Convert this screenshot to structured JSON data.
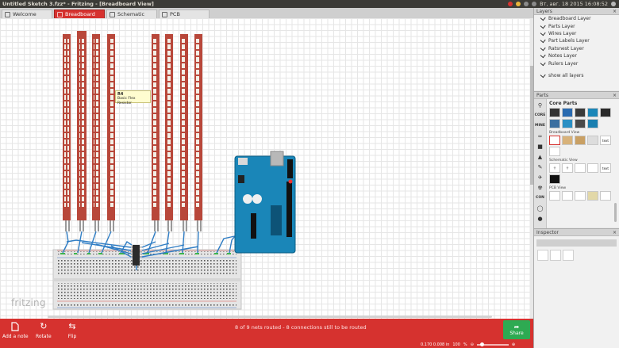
{
  "window": {
    "title": "Untitled Sketch 3.fzz* - Fritzing - [Breadboard View]",
    "clock": "Вт, авг. 18 2015 16:08:52"
  },
  "tabs": [
    {
      "label": "Welcome"
    },
    {
      "label": "Breadboard"
    },
    {
      "label": "Schematic"
    },
    {
      "label": "PCB"
    }
  ],
  "tooltip": {
    "title": "R4",
    "text": "Basic Flex Resistor"
  },
  "watermark": "fritzing",
  "toolbar": {
    "add_note": "Add a note",
    "rotate": "Rotate",
    "flip": "Flip",
    "share": "Share"
  },
  "status_text": "8 of 9 nets routed - 8 connections still to be routed",
  "coords": "0.170 0.008 in",
  "zoom": {
    "value": "100",
    "unit": "%"
  },
  "layers": {
    "title": "Layers",
    "items": [
      "Breadboard Layer",
      "Parts Layer",
      "Wires Layer",
      "Part Labels Layer",
      "Ratsnest Layer",
      "Notes Layer",
      "Rulers Layer"
    ],
    "show_all": "show all layers"
  },
  "parts": {
    "title": "Parts",
    "bin_title": "Core Parts",
    "side_labels": [
      "CORE",
      "MINE",
      "CON"
    ],
    "sections": {
      "breadboard": "Breadboard View",
      "schematic": "Schematic View",
      "pcb": "PCB View"
    },
    "cells": {
      "text1": "text",
      "text2": "text"
    }
  },
  "inspector": {
    "title": "Inspector"
  },
  "colors": {
    "accent": "#d6322f",
    "share": "#2eaa52",
    "wire": "#2f7dc4",
    "arduino": "#1a86b8"
  }
}
